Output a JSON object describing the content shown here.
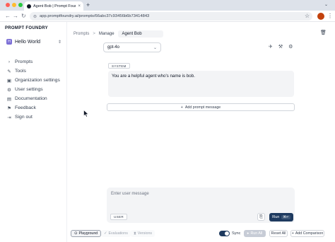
{
  "browser": {
    "tab_title": "Agent Bob | Prompt Foundry",
    "tab_close": "×",
    "new_tab": "+",
    "url": "app.promptfoundry.ai/prompts/66abc37c93456b6b73414843",
    "profile_initial": "",
    "icons": [
      "back-icon",
      "forward-icon",
      "reload-icon",
      "site-info-icon",
      "star-icon",
      "kebab-menu-icon"
    ]
  },
  "sidebar": {
    "brand": "PROMPT FOUNDRY",
    "workspace": {
      "initial": "H",
      "name": "Hello World"
    },
    "items": [
      {
        "label": "Prompts",
        "icon": "›"
      },
      {
        "label": "Tools",
        "icon": "✎"
      },
      {
        "label": "Organization settings",
        "icon": "▣"
      },
      {
        "label": "User settings",
        "icon": "⚙"
      },
      {
        "label": "Documentation",
        "icon": "▤"
      },
      {
        "label": "Feedback",
        "icon": "⚑"
      },
      {
        "label": "Sign out",
        "icon": "⇥"
      }
    ]
  },
  "breadcrumb": {
    "root": "Prompts",
    "separator": ">",
    "current": "Manage",
    "name": "Agent Bob"
  },
  "editor": {
    "model": "gpt-4o",
    "system_role": "SYSTEM",
    "system_message": "You are a helpful agent who's name is bob.",
    "add_message_label": "Add prompt message"
  },
  "composer": {
    "placeholder": "Enter user message",
    "role": "USER",
    "run_label": "Run",
    "run_shortcut": "⌘↵"
  },
  "footer": {
    "modes": [
      "Playground",
      "Evaluations",
      "Versions"
    ],
    "sync_label": "Sync",
    "sync_enabled": true,
    "run_all_label": "Run All",
    "reset_label": "Reset All",
    "compare_label": "Add Comparison"
  },
  "colors": {
    "accent": "#1e3a5f",
    "workspace_avatar": "#7c6fd6",
    "profile": "#c2410c"
  }
}
